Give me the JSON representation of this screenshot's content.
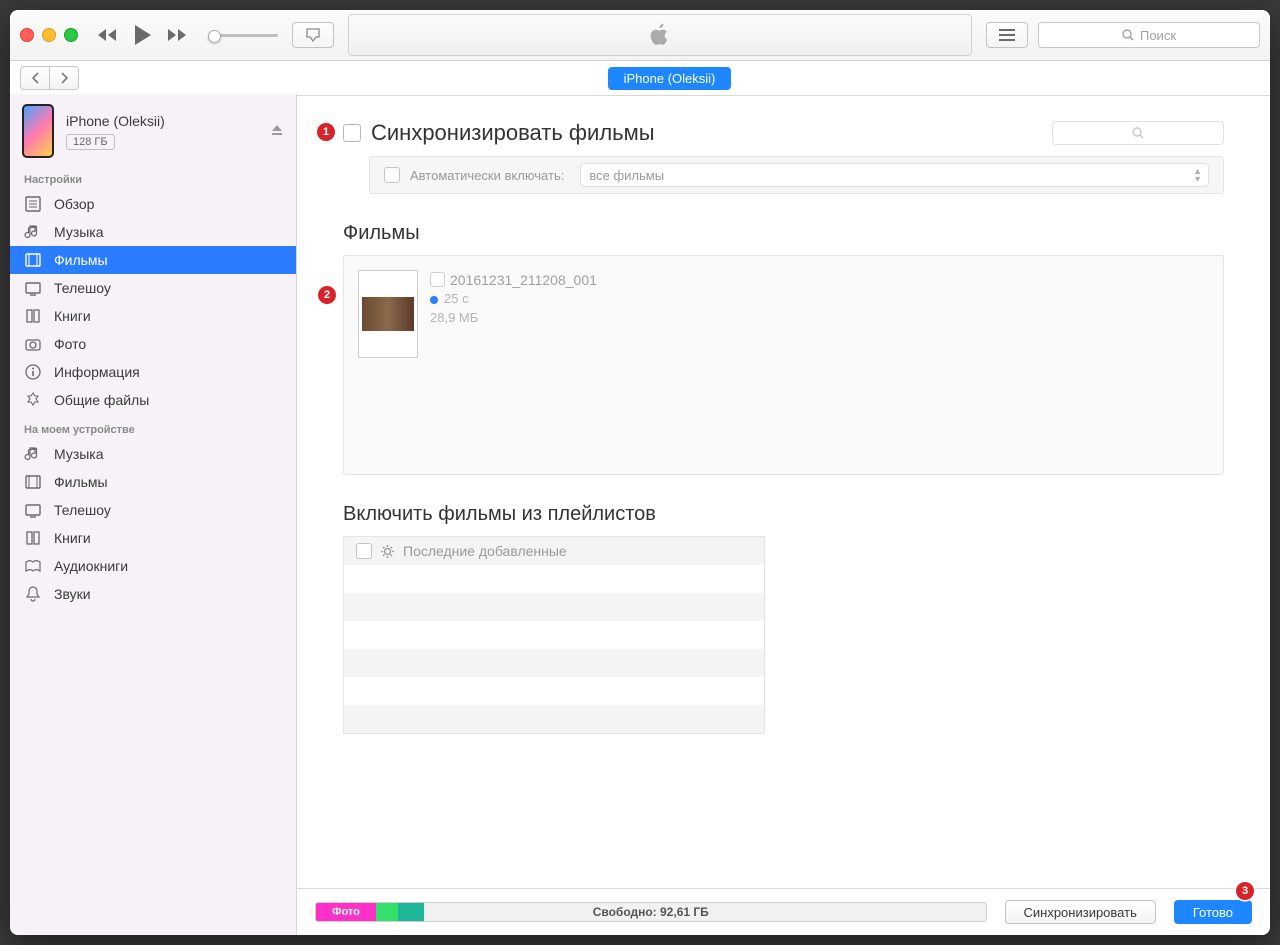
{
  "toolbar": {
    "search_placeholder": "Поиск",
    "device_pill": "iPhone (Oleksii)"
  },
  "device": {
    "name": "iPhone (Oleksii)",
    "capacity": "128 ГБ"
  },
  "sidebar": {
    "section_settings": "Настройки",
    "section_on_device": "На моем устройстве",
    "settings_items": [
      {
        "id": "summary",
        "label": "Обзор"
      },
      {
        "id": "music",
        "label": "Музыка"
      },
      {
        "id": "movies",
        "label": "Фильмы"
      },
      {
        "id": "tvshows",
        "label": "Телешоу"
      },
      {
        "id": "books",
        "label": "Книги"
      },
      {
        "id": "photos",
        "label": "Фото"
      },
      {
        "id": "info",
        "label": "Информация"
      },
      {
        "id": "files",
        "label": "Общие файлы"
      }
    ],
    "device_items": [
      {
        "id": "music",
        "label": "Музыка"
      },
      {
        "id": "movies",
        "label": "Фильмы"
      },
      {
        "id": "tvshows",
        "label": "Телешоу"
      },
      {
        "id": "books",
        "label": "Книги"
      },
      {
        "id": "audiobooks",
        "label": "Аудиокниги"
      },
      {
        "id": "tones",
        "label": "Звуки"
      }
    ]
  },
  "main": {
    "sync_title": "Синхронизировать фильмы",
    "auto_include_label": "Автоматически включать:",
    "auto_include_value": "все фильмы",
    "movies_header": "Фильмы",
    "movie": {
      "name": "20161231_211208_001",
      "duration": "25 с",
      "size": "28,9 МБ"
    },
    "playlists_header": "Включить фильмы из плейлистов",
    "playlist0": "Последние добавленные"
  },
  "footer": {
    "photo_label": "Фото",
    "free_label": "Свободно: 92,61 ГБ",
    "sync_btn": "Синхронизировать",
    "done_btn": "Готово"
  },
  "badges": {
    "b1": "1",
    "b2": "2",
    "b3": "3"
  }
}
